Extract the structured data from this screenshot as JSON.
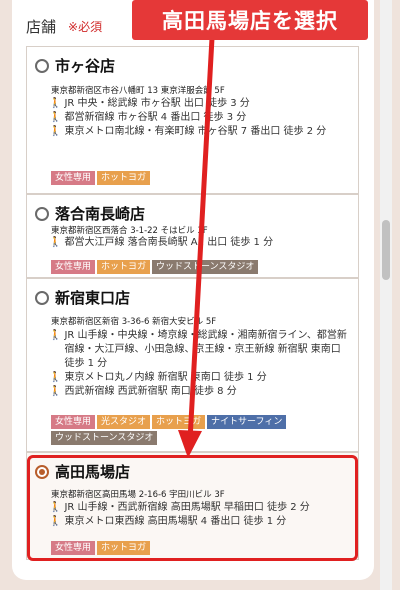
{
  "section": {
    "label": "店舗",
    "required": "※必須"
  },
  "stores": [
    {
      "name": "市ヶ谷店",
      "address": "東京都新宿区市谷八幡町 13 東京洋服会館 5F",
      "access": [
        "JR 中央・総武線 市ヶ谷駅 出口 徒歩 3 分",
        "都営新宿線 市ヶ谷駅 4 番出口 徒歩 3 分",
        "東京メトロ南北線・有楽町線 市ヶ谷駅 7 番出口 徒歩 2 分"
      ],
      "tags": [
        "女性専用",
        "ホットヨガ"
      ],
      "checked": false
    },
    {
      "name": "落合南長崎店",
      "address": "東京都新宿区西落合 3-1-22 そはビル 3F",
      "access": [
        "都営大江戸線 落合南長崎駅 A1 出口 徒歩 1 分"
      ],
      "tags": [
        "女性専用",
        "ホットヨガ",
        "ウッドストーンスタジオ"
      ],
      "checked": false
    },
    {
      "name": "新宿東口店",
      "address": "東京都新宿区新宿 3-36-6 新宿大安ビル 5F",
      "access": [
        "JR 山手線・中央線・埼京線・総武線・湘南新宿ライン、都営新宿線・大江戸線、小田急線、京王線・京王新線 新宿駅 東南口 徒歩 1 分",
        "東京メトロ丸ノ内線 新宿駅 東南口 徒歩 1 分",
        "西武新宿線 西武新宿駅 南口 徒歩 8 分"
      ],
      "tags": [
        "女性専用",
        "光スタジオ",
        "ホットヨガ",
        "ナイトサーフィン",
        "ウッドストーンスタジオ"
      ],
      "checked": false
    },
    {
      "name": "高田馬場店",
      "address": "東京都新宿区高田馬場 2-16-6 宇田川ビル 3F",
      "access": [
        "JR 山手線・西武新宿線 高田馬場駅 早稲田口 徒歩 2 分",
        "東京メトロ東西線 高田馬場駅 4 番出口 徒歩 1 分"
      ],
      "tags": [
        "女性専用",
        "ホットヨガ"
      ],
      "checked": true
    }
  ],
  "annotation": {
    "banner": "高田馬場店を選択"
  },
  "icons": {
    "walk": "walking-person-icon"
  },
  "colors": {
    "accent": "#e53838",
    "radio_selected": "#b85d2b"
  }
}
